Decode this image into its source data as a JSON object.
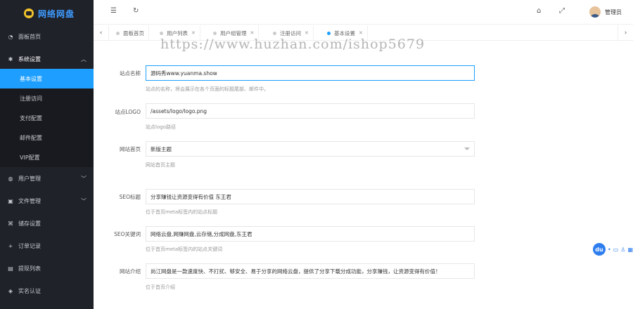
{
  "app": {
    "name": "网络网盘"
  },
  "sidebar": {
    "items": [
      {
        "icon": "dashboard-icon",
        "label": "面板首页"
      },
      {
        "icon": "gear-icon",
        "label": "系统设置"
      },
      {
        "icon": "user-icon",
        "label": "用户管理"
      },
      {
        "icon": "file-icon",
        "label": "文件管理"
      },
      {
        "icon": "storage-icon",
        "label": "储存设置"
      },
      {
        "icon": "order-icon",
        "label": "订单记录"
      },
      {
        "icon": "withdraw-icon",
        "label": "提现列表"
      },
      {
        "icon": "verify-icon",
        "label": "实名认证"
      }
    ],
    "submenu": [
      "基本设置",
      "注册访问",
      "支付配置",
      "邮件配置",
      "VIP配置"
    ]
  },
  "header": {
    "admin_label": "管理员"
  },
  "tabs": [
    {
      "label": "面板首页"
    },
    {
      "label": "用户列表"
    },
    {
      "label": "用户组管理"
    },
    {
      "label": "注册访问"
    },
    {
      "label": "基本设置"
    }
  ],
  "form": {
    "site_name": {
      "label": "站点名称",
      "value": "源码秀www.yuanma.show",
      "hint": "站点的名称，将会展示在各个页面的标题尾部、邮件中。"
    },
    "site_logo": {
      "label": "站点LOGO",
      "value": "/assets/logo/logo.png",
      "hint": "站点logo路径"
    },
    "home": {
      "label": "网站首页",
      "value": "新版主题",
      "hint": "网站首页主题"
    },
    "seo_title": {
      "label": "SEO标题",
      "value": "分享赚钱让资源变得有价值 东王君",
      "hint": "位于首页meta标签内的站点标题"
    },
    "seo_keywords": {
      "label": "SEO关键词",
      "value": "网络云盘,网赚网盘,云存储,分成网盘,东王君",
      "hint": "位于首页meta标签内的站点关键词"
    },
    "intro": {
      "label": "网站介绍",
      "value": "尚江网盘是一款速度快、不打扰、够安全、易于分享的网络云盘，提供了分享下载分成功能，分享赚钱，让资源变得有价值！",
      "hint": "位于首页介绍"
    }
  },
  "watermark": "https://www.huzhan.com/ishop5679",
  "floatbar": {
    "badge": "du"
  }
}
